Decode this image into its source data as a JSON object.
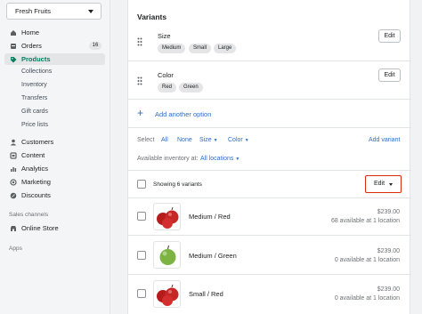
{
  "store": {
    "name": "Fresh Fruits"
  },
  "nav": {
    "items": [
      {
        "label": "Home",
        "icon": "home-icon"
      },
      {
        "label": "Orders",
        "icon": "orders-icon",
        "badge": "16"
      },
      {
        "label": "Products",
        "icon": "tag-icon",
        "active": true
      },
      {
        "label": "Customers",
        "icon": "person-icon"
      },
      {
        "label": "Content",
        "icon": "content-icon"
      },
      {
        "label": "Analytics",
        "icon": "analytics-icon"
      },
      {
        "label": "Marketing",
        "icon": "marketing-icon"
      },
      {
        "label": "Discounts",
        "icon": "discount-icon"
      }
    ],
    "sub_items": [
      "Collections",
      "Inventory",
      "Transfers",
      "Gift cards",
      "Price lists"
    ],
    "sales_channels_label": "Sales channels",
    "online_store": "Online Store",
    "apps_label": "Apps"
  },
  "variants": {
    "title": "Variants",
    "options": [
      {
        "name": "Size",
        "values": [
          "Medium",
          "Small",
          "Large"
        ],
        "edit_label": "Edit"
      },
      {
        "name": "Color",
        "values": [
          "Red",
          "Green"
        ],
        "edit_label": "Edit"
      }
    ],
    "add_option_label": "Add another option",
    "select_label": "Select",
    "select_all": "All",
    "select_none": "None",
    "size_filter": "Size",
    "color_filter": "Color",
    "add_variant_label": "Add variant",
    "inventory_label": "Available inventory at:",
    "inventory_location": "All locations",
    "showing_label": "Showing 6 variants",
    "bulk_edit_label": "Edit",
    "rows": [
      {
        "name": "Medium / Red",
        "price": "$239.00",
        "availability": "68 available at 1 location",
        "image": "red-apples"
      },
      {
        "name": "Medium / Green",
        "price": "$239.00",
        "availability": "0 available at 1 location",
        "image": "green-apple"
      },
      {
        "name": "Small / Red",
        "price": "$239.00",
        "availability": "0 available at 1 location",
        "image": "red-apples"
      }
    ]
  },
  "colors": {
    "accent": "#2c6ecb",
    "active_nav": "#007f5f",
    "highlight_border": "#d82c0d"
  }
}
